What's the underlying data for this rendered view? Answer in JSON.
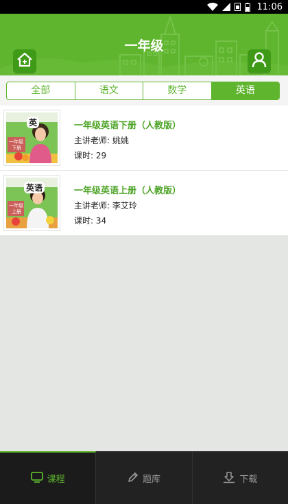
{
  "status": {
    "time": "11:06",
    "icons": [
      "wifi-icon",
      "signal-icon",
      "sim-icon",
      "battery-icon"
    ]
  },
  "header": {
    "title": "一年级",
    "home_icon": "home-icon",
    "user_icon": "user-icon"
  },
  "tabs": [
    {
      "label": "全部",
      "active": false
    },
    {
      "label": "语文",
      "active": false
    },
    {
      "label": "数学",
      "active": false
    },
    {
      "label": "英语",
      "active": true
    }
  ],
  "courses": [
    {
      "title": "一年级英语下册（人教版）",
      "teacher": "主讲老师: 姚姚",
      "hours": "课时: 29",
      "cover_text": "英",
      "cover_sub": [
        "一年级",
        "下册"
      ]
    },
    {
      "title": "一年级英语上册（人教版）",
      "teacher": "主讲老师: 李艾玲",
      "hours": "课时: 34",
      "cover_text": "英语",
      "cover_sub": [
        "一年级",
        "上册"
      ]
    }
  ],
  "bottom_nav": [
    {
      "label": "课程",
      "icon": "monitor-icon",
      "active": true
    },
    {
      "label": "题库",
      "icon": "pencil-icon",
      "active": false
    },
    {
      "label": "下载",
      "icon": "download-icon",
      "active": false
    }
  ],
  "colors": {
    "accent": "#5fb52e",
    "accent_dark": "#3f9a17",
    "nav_bg": "#222222",
    "page_bg": "#e3e6e3"
  }
}
